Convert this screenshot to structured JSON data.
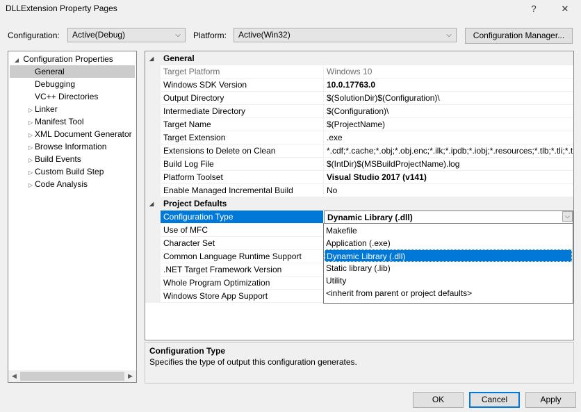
{
  "window": {
    "title": "DLLExtension Property Pages",
    "help_btn": "?",
    "close_btn": "✕"
  },
  "toolbar": {
    "config_label": "Configuration:",
    "config_value": "Active(Debug)",
    "platform_label": "Platform:",
    "platform_value": "Active(Win32)",
    "config_manager": "Configuration Manager..."
  },
  "tree": {
    "root": "Configuration Properties",
    "items": [
      {
        "label": "General",
        "expandable": false,
        "selected": true
      },
      {
        "label": "Debugging",
        "expandable": false
      },
      {
        "label": "VC++ Directories",
        "expandable": false
      },
      {
        "label": "Linker",
        "expandable": true
      },
      {
        "label": "Manifest Tool",
        "expandable": true
      },
      {
        "label": "XML Document Generator",
        "expandable": true
      },
      {
        "label": "Browse Information",
        "expandable": true
      },
      {
        "label": "Build Events",
        "expandable": true
      },
      {
        "label": "Custom Build Step",
        "expandable": true
      },
      {
        "label": "Code Analysis",
        "expandable": true
      }
    ]
  },
  "grid": {
    "general_header": "General",
    "general_rows": [
      {
        "name": "Target Platform",
        "value": "Windows 10"
      },
      {
        "name": "Windows SDK Version",
        "value": "10.0.17763.0"
      },
      {
        "name": "Output Directory",
        "value": "$(SolutionDir)$(Configuration)\\"
      },
      {
        "name": "Intermediate Directory",
        "value": "$(Configuration)\\"
      },
      {
        "name": "Target Name",
        "value": "$(ProjectName)"
      },
      {
        "name": "Target Extension",
        "value": ".exe"
      },
      {
        "name": "Extensions to Delete on Clean",
        "value": "*.cdf;*.cache;*.obj;*.obj.enc;*.ilk;*.ipdb;*.iobj;*.resources;*.tlb;*.tli;*.t"
      },
      {
        "name": "Build Log File",
        "value": "$(IntDir)$(MSBuildProjectName).log"
      },
      {
        "name": "Platform Toolset",
        "value": "Visual Studio 2017 (v141)"
      },
      {
        "name": "Enable Managed Incremental Build",
        "value": "No"
      }
    ],
    "defaults_header": "Project Defaults",
    "defaults_rows": [
      {
        "name": "Configuration Type",
        "value": "Dynamic Library (.dll)"
      },
      {
        "name": "Use of MFC",
        "value": ""
      },
      {
        "name": "Character Set",
        "value": ""
      },
      {
        "name": "Common Language Runtime Support",
        "value": ""
      },
      {
        "name": ".NET Target Framework Version",
        "value": ""
      },
      {
        "name": "Whole Program Optimization",
        "value": ""
      },
      {
        "name": "Windows Store App Support",
        "value": ""
      }
    ]
  },
  "dropdown": {
    "options": [
      "Makefile",
      "Application (.exe)",
      "Dynamic Library (.dll)",
      "Static library (.lib)",
      "Utility",
      "<inherit from parent or project defaults>"
    ],
    "selected_index": 2
  },
  "description": {
    "title": "Configuration Type",
    "text": "Specifies the type of output this configuration generates."
  },
  "buttons": {
    "ok": "OK",
    "cancel": "Cancel",
    "apply": "Apply"
  }
}
